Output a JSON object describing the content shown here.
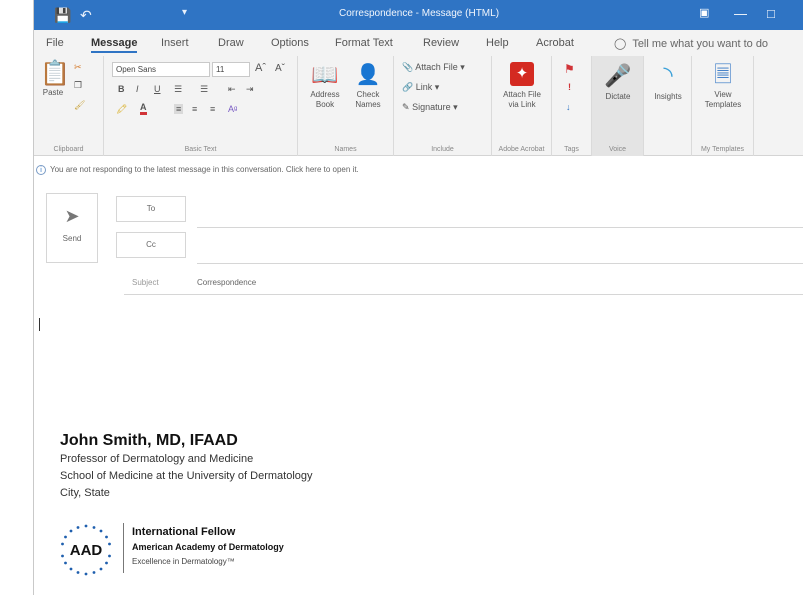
{
  "window": {
    "title": "Correspondence  -  Message (HTML)"
  },
  "tabs": [
    "File",
    "Message",
    "Insert",
    "Draw",
    "Options",
    "Format Text",
    "Review",
    "Help",
    "Acrobat"
  ],
  "tell_me": "Tell me what you want to do",
  "ribbon": {
    "clipboard": {
      "paste": "Paste",
      "label": "Clipboard"
    },
    "basic_text": {
      "font_name": "Open Sans",
      "font_size": "11",
      "label": "Basic Text"
    },
    "names": {
      "address_book": "Address Book",
      "check_names": "Check Names",
      "label": "Names"
    },
    "include": {
      "attach_file": "Attach File",
      "link": "Link",
      "signature": "Signature",
      "label": "Include"
    },
    "adobe": {
      "attach_via_link": "Attach File via Link",
      "label": "Adobe Acrobat"
    },
    "tags": {
      "label": "Tags"
    },
    "voice": {
      "dictate": "Dictate",
      "label": "Voice"
    },
    "insights": {
      "label": "Insights"
    },
    "templates": {
      "view": "View Templates",
      "label": "My Templates"
    }
  },
  "info_bar": "You are not responding to the latest message in this conversation. Click here to open it.",
  "compose": {
    "send": "Send",
    "to": "To",
    "cc": "Cc",
    "subject_label": "Subject",
    "subject_value": "Correspondence"
  },
  "signature": {
    "name": "John Smith, MD, IFAAD",
    "lines": [
      "Professor of Dermatology and Medicine",
      "School of Medicine at the University of Dermatology",
      "City, State"
    ],
    "logo_text": "AAD",
    "fellow_title": "International Fellow",
    "academy": "American Academy of Dermatology",
    "tagline": "Excellence in Dermatology™"
  },
  "colors": {
    "accent": "#2f74c4",
    "ribbon_bg": "#f3f3f3",
    "acrobat_red": "#d42a21",
    "flag_red": "#d13438",
    "aad_blue": "#1f5fae"
  }
}
